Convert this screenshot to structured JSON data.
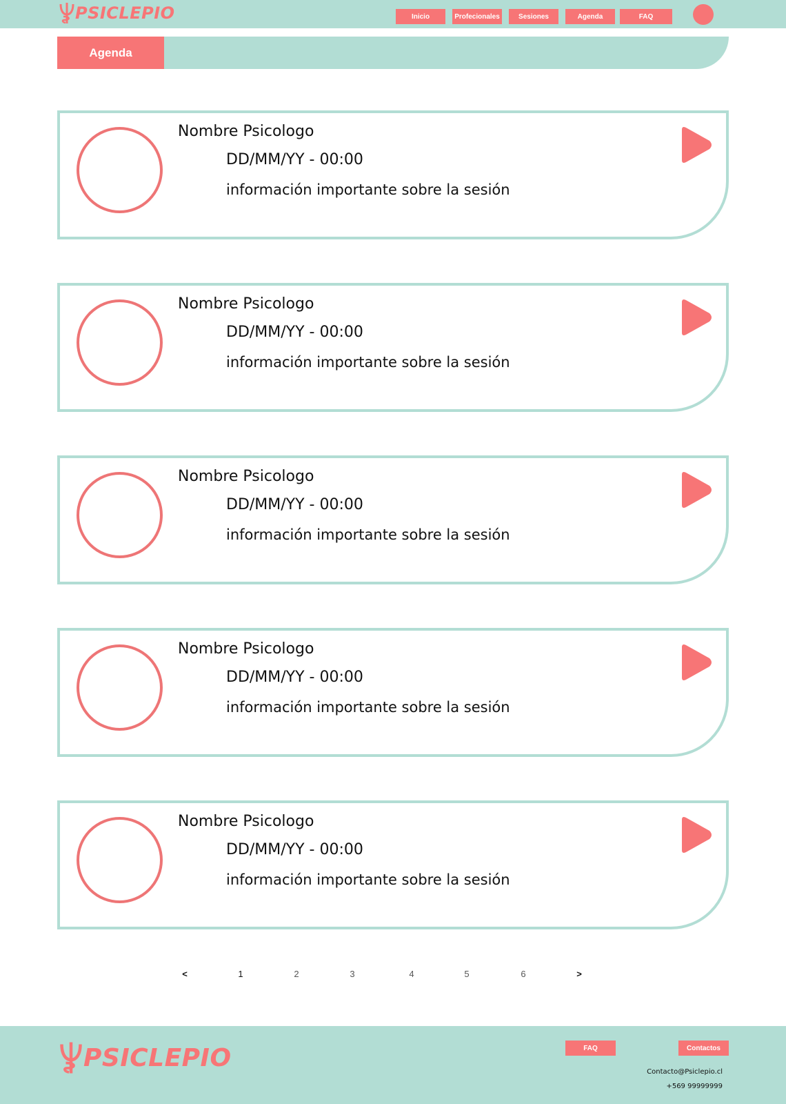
{
  "brand": {
    "name": "PSICLEPIO",
    "accent_color": "#f77576",
    "secondary_color": "#b2ddd4"
  },
  "header": {
    "logo_text": "PSICLEPIO",
    "nav": [
      "Inicio",
      "Profecionales",
      "Sesiones",
      "Agenda",
      "FAQ"
    ],
    "avatar_icon": "user-avatar-icon"
  },
  "page": {
    "title": "Agenda"
  },
  "sessions": [
    {
      "name": "Nombre Psicologo",
      "datetime": "DD/MM/YY - 00:00",
      "info": "información importante sobre la sesión",
      "action_icon": "play-icon"
    },
    {
      "name": "Nombre Psicologo",
      "datetime": "DD/MM/YY - 00:00",
      "info": "información importante sobre la sesión",
      "action_icon": "play-icon"
    },
    {
      "name": "Nombre Psicologo",
      "datetime": "DD/MM/YY - 00:00",
      "info": "información importante sobre la sesión",
      "action_icon": "play-icon"
    },
    {
      "name": "Nombre Psicologo",
      "datetime": "DD/MM/YY - 00:00",
      "info": "información importante sobre la sesión",
      "action_icon": "play-icon"
    },
    {
      "name": "Nombre Psicologo",
      "datetime": "DD/MM/YY - 00:00",
      "info": "información importante sobre la sesión",
      "action_icon": "play-icon"
    }
  ],
  "pagination": {
    "prev": "<",
    "pages": [
      "1",
      "2",
      "3",
      "4",
      "5",
      "6"
    ],
    "current": "1",
    "next": ">"
  },
  "footer": {
    "logo_text": "PSICLEPIO",
    "faq_label": "FAQ",
    "contact_label": "Contactos",
    "email": "Contacto@Psiclepio.cl",
    "phone": "+569 99999999"
  }
}
